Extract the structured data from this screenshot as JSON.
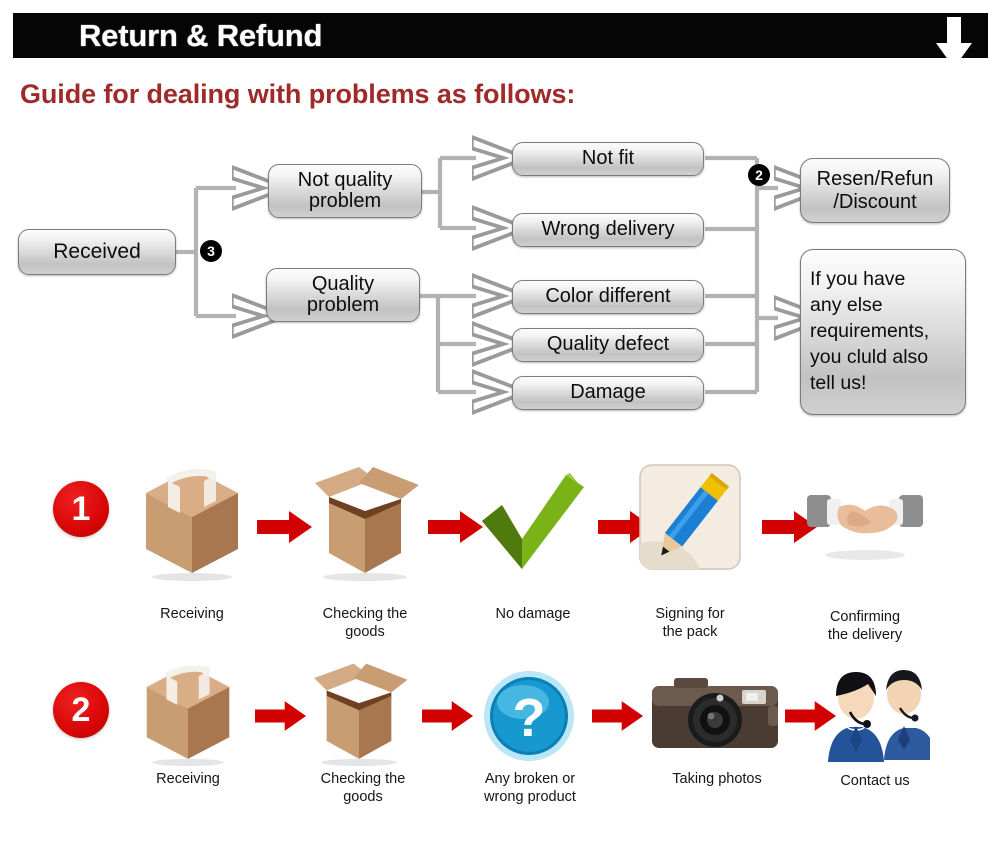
{
  "header": {
    "title": "Return & Refund",
    "arrow_icon": "down-arrow-icon"
  },
  "guide": {
    "heading": "Guide for dealing with problems as follows:"
  },
  "flowchart": {
    "badges": {
      "left": "3",
      "right": "2"
    },
    "nodes": {
      "received": "Received",
      "not_quality_problem": "Not quality\nproblem",
      "quality_problem": "Quality\nproblem",
      "not_fit": "Not fit",
      "wrong_delivery": "Wrong delivery",
      "color_different": "Color different",
      "quality_defect": "Quality defect",
      "damage": "Damage",
      "resend_refund_discount": "Resen/Refun\n/Discount",
      "any_else": "If you have\nany else\nrequirements,\nyou cluld also\ntell us!"
    }
  },
  "steps": [
    {
      "number": "1",
      "items": [
        {
          "icon": "sealed-box-icon",
          "label": "Receiving"
        },
        {
          "icon": "open-box-icon",
          "label": "Checking the\ngoods"
        },
        {
          "icon": "green-check-icon",
          "label": "No damage"
        },
        {
          "icon": "pencil-signing-icon",
          "label": "Signing for\nthe pack"
        },
        {
          "icon": "handshake-icon",
          "label": "Confirming\nthe delivery"
        }
      ]
    },
    {
      "number": "2",
      "items": [
        {
          "icon": "sealed-box-icon",
          "label": "Receiving"
        },
        {
          "icon": "open-box-icon",
          "label": "Checking the\ngoods"
        },
        {
          "icon": "question-mark-icon",
          "label": "Any broken or\nwrong product"
        },
        {
          "icon": "camera-icon",
          "label": "Taking photos"
        },
        {
          "icon": "support-agents-icon",
          "label": "Contact us"
        }
      ]
    }
  ],
  "colors": {
    "header_bg": "#050505",
    "heading_red": "#9e2b29",
    "arrow_red": "#d30000",
    "badge_black": "#000000",
    "node_border": "#7b7b7b"
  }
}
